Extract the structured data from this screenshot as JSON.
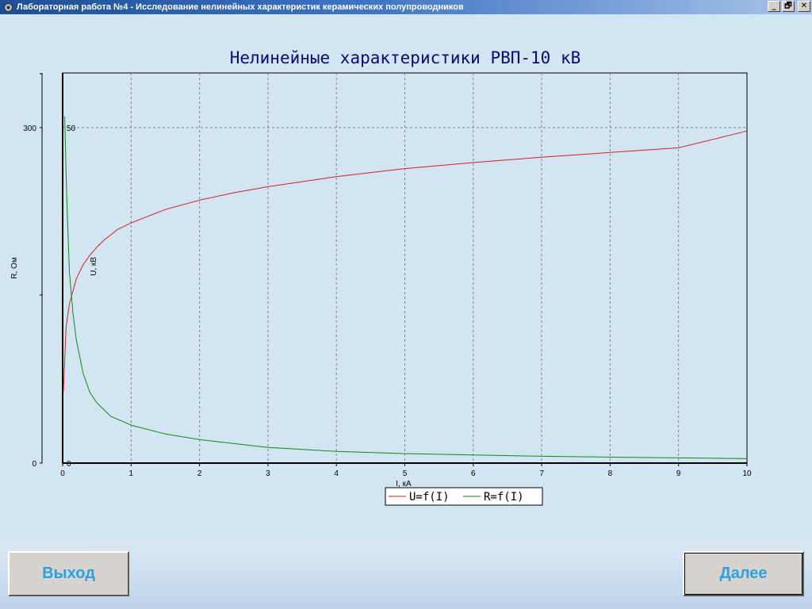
{
  "window": {
    "title": "Лабораторная работа №4 - Исследование нелинейных характеристик керамических полупроводников",
    "icon": "gear-icon",
    "buttons": {
      "minimize": "_",
      "restore": "🗗",
      "close": "✕"
    }
  },
  "buttons": {
    "exit_label": "Выход",
    "next_label": "Далее"
  },
  "colors": {
    "background": "#d2e6f2",
    "title_color": "#0a0a78",
    "u_series": "#d42020",
    "r_series": "#138a13",
    "grid": "#808080",
    "button_text": "#29a3e0"
  },
  "chart_data": {
    "type": "line",
    "title": "Нелинейные характеристики РВП-10 кВ",
    "xlabel": "I, кА",
    "ylabel_left": "R, Ом",
    "ylabel_inner": "U, кВ",
    "xlim": [
      0,
      10
    ],
    "ylim_left": [
      0,
      300
    ],
    "ylim_right_scale": [
      0,
      50
    ],
    "x_ticks": [
      "0",
      "1",
      "2",
      "3",
      "4",
      "5",
      "6",
      "7",
      "8",
      "9",
      "10"
    ],
    "y_ticks_left": [
      "0",
      "300"
    ],
    "y_ticks_inner": [
      "0",
      "50"
    ],
    "grid": true,
    "legend_position": "bottom-center",
    "series": [
      {
        "name": "U=f(I)",
        "x": [
          0.01,
          0.05,
          0.1,
          0.2,
          0.3,
          0.4,
          0.5,
          0.6,
          0.8,
          1.0,
          1.5,
          2.0,
          2.5,
          3.0,
          4.0,
          5.0,
          6.0,
          7.0,
          8.0,
          9.0,
          10.0
        ],
        "y": [
          10.5,
          20.3,
          23.8,
          27.5,
          29.6,
          31.0,
          32.2,
          33.2,
          34.8,
          35.8,
          37.8,
          39.2,
          40.3,
          41.2,
          42.7,
          43.9,
          44.8,
          45.6,
          46.3,
          47.0,
          49.5
        ]
      },
      {
        "name": "R=f(I)",
        "x": [
          0.03,
          0.05,
          0.07,
          0.1,
          0.15,
          0.2,
          0.3,
          0.4,
          0.5,
          0.7,
          1.0,
          1.5,
          2.0,
          3.0,
          4.0,
          5.0,
          6.0,
          7.0,
          8.0,
          9.0,
          10.0
        ],
        "y": [
          310,
          260,
          220,
          170,
          135,
          110,
          80,
          63,
          54,
          42,
          34,
          26,
          21,
          14,
          10.5,
          8.5,
          7.2,
          6.1,
          5.3,
          4.7,
          4.0
        ]
      }
    ]
  }
}
